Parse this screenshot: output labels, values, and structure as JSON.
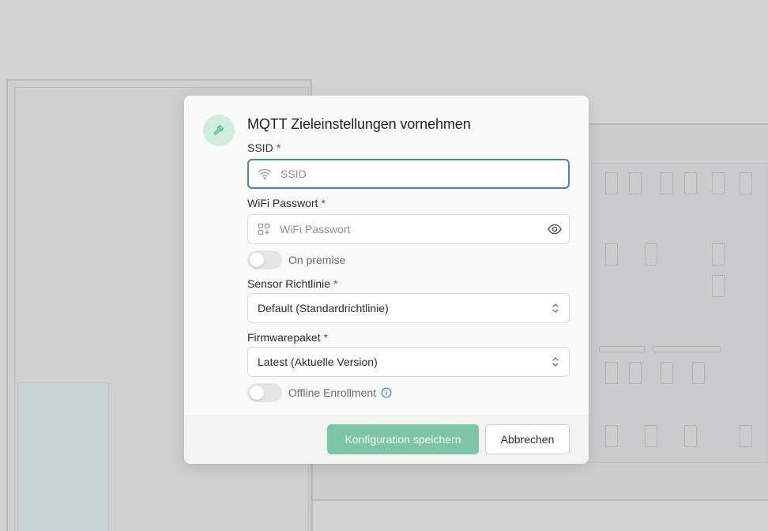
{
  "dialog": {
    "title": "MQTT Zieleinstellungen vornehmen",
    "icon": "wrench-icon",
    "accent_color": "#7ec5a8"
  },
  "form": {
    "ssid": {
      "label": "SSID",
      "required_mark": "*",
      "placeholder": "SSID",
      "value": "",
      "icon": "wifi-icon"
    },
    "wifi_password": {
      "label": "WiFi Passwort",
      "required_mark": "*",
      "placeholder": "WiFi Passwort",
      "value": "",
      "icon": "grid-plus-icon",
      "toggle_visibility_icon": "eye-icon"
    },
    "on_premise": {
      "label": "On premise",
      "checked": false
    },
    "sensor_policy": {
      "label": "Sensor Richtlinie",
      "required_mark": "*",
      "selected": "Default (Standardrichtlinie)"
    },
    "firmware": {
      "label": "Firmwarepaket",
      "required_mark": "*",
      "selected": "Latest (Aktuelle Version)"
    },
    "offline_enrollment": {
      "label": "Offline Enrollment",
      "checked": false,
      "info_icon": "info-icon"
    }
  },
  "footer": {
    "save_label": "Konfiguration speichern",
    "cancel_label": "Abbrechen"
  }
}
